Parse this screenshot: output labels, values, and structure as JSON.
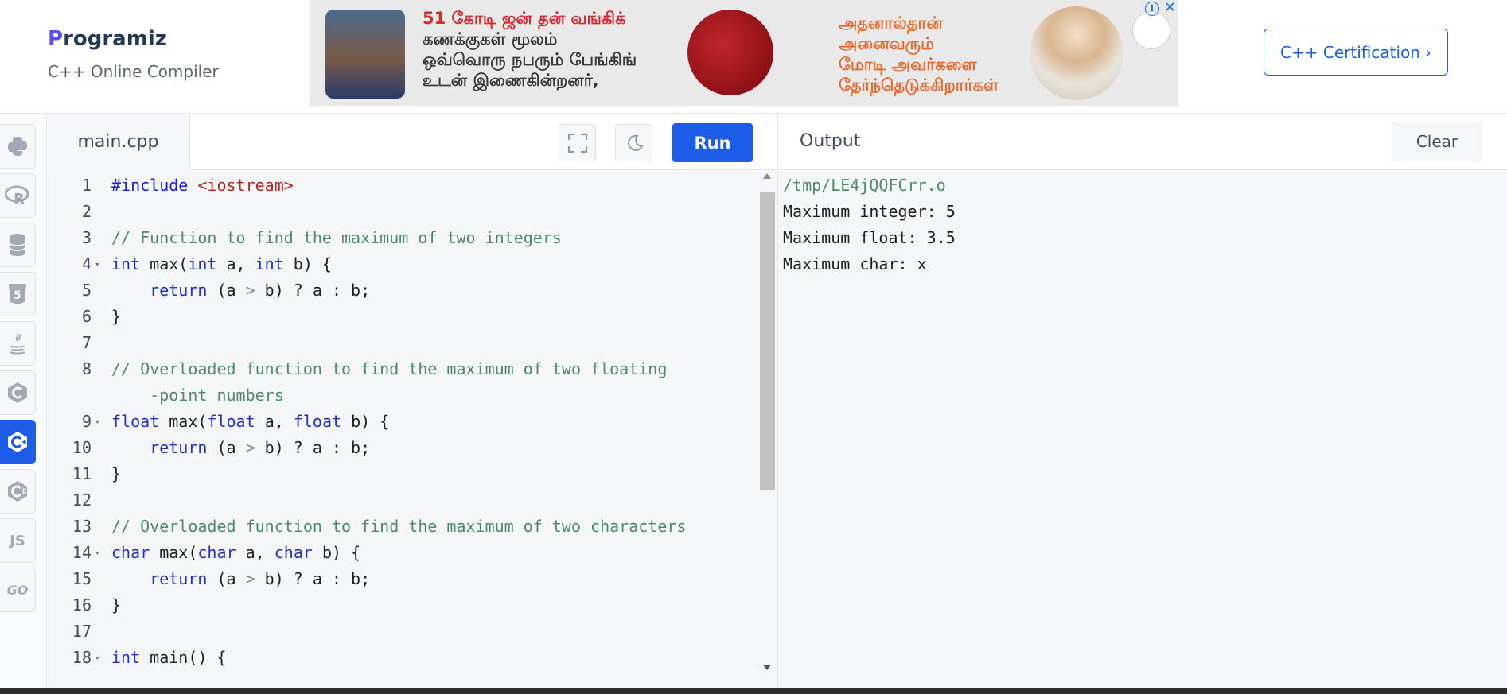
{
  "header": {
    "logo_text": "rogramiz",
    "logo_initial": "P",
    "subtitle": "C++ Online Compiler",
    "cert_button": "C++ Certification",
    "cert_chevron": "›"
  },
  "ad": {
    "left_text": [
      "51 கோடி ஜன் தன் வங்கிக்",
      "கணக்குகள் மூலம்",
      "ஒவ்வொரு நபரும் பேங்கிங்",
      "உடன் இணைகின்றனர்,"
    ],
    "right_text": [
      "அதனால்தான்",
      "அனைவரும்",
      "மோடி அவர்களை",
      "தேர்ந்தெடுக்கிறார்கள்"
    ],
    "info_icon": "i",
    "close_icon": "✕"
  },
  "sidebar": {
    "items": [
      {
        "name": "python",
        "icon": "python-icon",
        "glyph": "🐍"
      },
      {
        "name": "r",
        "icon": "r-icon",
        "glyph": "R"
      },
      {
        "name": "sql",
        "icon": "database-icon",
        "glyph": "⛁"
      },
      {
        "name": "html",
        "icon": "html5-icon",
        "glyph": "5"
      },
      {
        "name": "java",
        "icon": "java-icon",
        "glyph": "☕"
      },
      {
        "name": "c",
        "icon": "c-icon",
        "glyph": "C"
      },
      {
        "name": "cpp",
        "icon": "cpp-icon",
        "glyph": "C+",
        "active": true
      },
      {
        "name": "csharp",
        "icon": "csharp-icon",
        "glyph": "C#"
      },
      {
        "name": "js",
        "icon": "js-icon",
        "glyph": "JS"
      },
      {
        "name": "go",
        "icon": "go-icon",
        "glyph": "GO"
      }
    ]
  },
  "editor": {
    "file_tab": "main.cpp",
    "run_label": "Run",
    "lines": [
      {
        "n": "1",
        "fold": ""
      },
      {
        "n": "2",
        "fold": ""
      },
      {
        "n": "3",
        "fold": ""
      },
      {
        "n": "4",
        "fold": "▾"
      },
      {
        "n": "5",
        "fold": ""
      },
      {
        "n": "6",
        "fold": ""
      },
      {
        "n": "7",
        "fold": ""
      },
      {
        "n": "8",
        "fold": ""
      },
      {
        "n": "9",
        "fold": "▾"
      },
      {
        "n": "10",
        "fold": ""
      },
      {
        "n": "11",
        "fold": ""
      },
      {
        "n": "12",
        "fold": ""
      },
      {
        "n": "13",
        "fold": ""
      },
      {
        "n": "14",
        "fold": "▾"
      },
      {
        "n": "15",
        "fold": ""
      },
      {
        "n": "16",
        "fold": ""
      },
      {
        "n": "17",
        "fold": ""
      },
      {
        "n": "18",
        "fold": "▾"
      }
    ],
    "code": {
      "l1_kw": "#include",
      "l1_str": "<iostream>",
      "l3": "// Function to find the maximum of two integers",
      "l4_t1": "int",
      "l4_a": " max(",
      "l4_t2": "int",
      "l4_b": " a, ",
      "l4_t3": "int",
      "l4_c": " b) {",
      "ret_kw": "return",
      "ret_a": " (a ",
      "ret_op": ">",
      "ret_b": " b) ? a : b;",
      "close": "}",
      "l8a": "// Overloaded function to find the maximum of two floating",
      "l8b": "-point numbers",
      "l9_t1": "float",
      "l9_a": " max(",
      "l9_t2": "float",
      "l9_b": " a, ",
      "l9_t3": "float",
      "l9_c": " b) {",
      "l13": "// Overloaded function to find the maximum of two characters",
      "l14_t1": "char",
      "l14_a": " max(",
      "l14_t2": "char",
      "l14_b": " a, ",
      "l14_t3": "char",
      "l14_c": " b) {",
      "l18_t1": "int",
      "l18_a": " main() {"
    }
  },
  "output": {
    "title": "Output",
    "clear_label": "Clear",
    "lines": [
      "/tmp/LE4jQQFCrr.o",
      "Maximum integer: 5",
      "Maximum float: 3.5",
      "Maximum char: x"
    ]
  }
}
